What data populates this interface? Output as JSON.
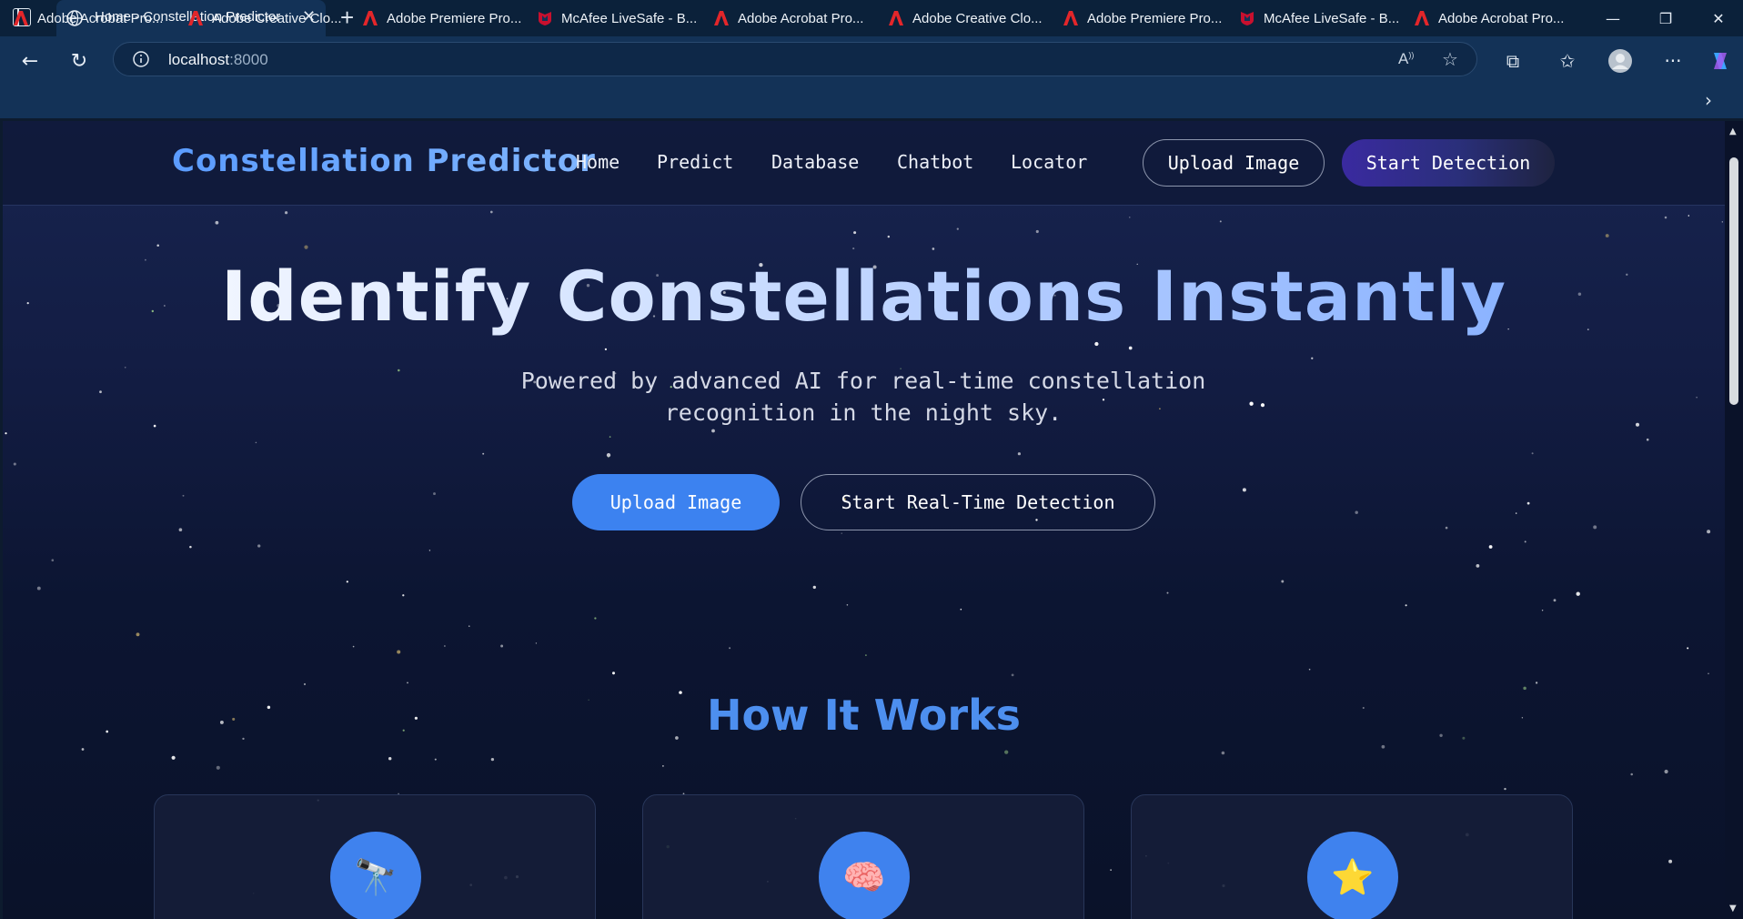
{
  "browser": {
    "tab_title": "Home - Constellation Predictor",
    "url_host": "localhost",
    "url_port": ":8000",
    "bookmarks": [
      {
        "label": "Adobe Acrobat Pro...",
        "icon": "adobe-icon"
      },
      {
        "label": "Adobe Creative Clo...",
        "icon": "adobe-icon"
      },
      {
        "label": "Adobe Premiere Pro...",
        "icon": "adobe-icon"
      },
      {
        "label": "McAfee LiveSafe - B...",
        "icon": "mcafee-icon"
      },
      {
        "label": "Adobe Acrobat Pro...",
        "icon": "adobe-icon"
      },
      {
        "label": "Adobe Creative Clo...",
        "icon": "adobe-icon"
      },
      {
        "label": "Adobe Premiere Pro...",
        "icon": "adobe-icon"
      },
      {
        "label": "McAfee LiveSafe - B...",
        "icon": "mcafee-icon"
      },
      {
        "label": "Adobe Acrobat Pro...",
        "icon": "adobe-icon"
      }
    ]
  },
  "site": {
    "brand": "Constellation Predictor",
    "nav": [
      "Home",
      "Predict",
      "Database",
      "Chatbot",
      "Locator"
    ],
    "nav_upload": "Upload Image",
    "nav_start": "Start Detection"
  },
  "hero": {
    "title": "Identify Constellations Instantly",
    "subtitle": "Powered by advanced AI for real-time constellation recognition in the night sky.",
    "primary_button": "Upload Image",
    "secondary_button": "Start Real-Time Detection"
  },
  "how": {
    "title": "How It Works",
    "cards": [
      {
        "icon": "telescope-icon",
        "glyph": "🔭"
      },
      {
        "icon": "brain-icon",
        "glyph": "🧠"
      },
      {
        "icon": "star-icon",
        "glyph": "⭐"
      }
    ]
  },
  "colors": {
    "accent": "#3c82f0",
    "brand": "#5b9cff",
    "background": "#0c1532"
  }
}
